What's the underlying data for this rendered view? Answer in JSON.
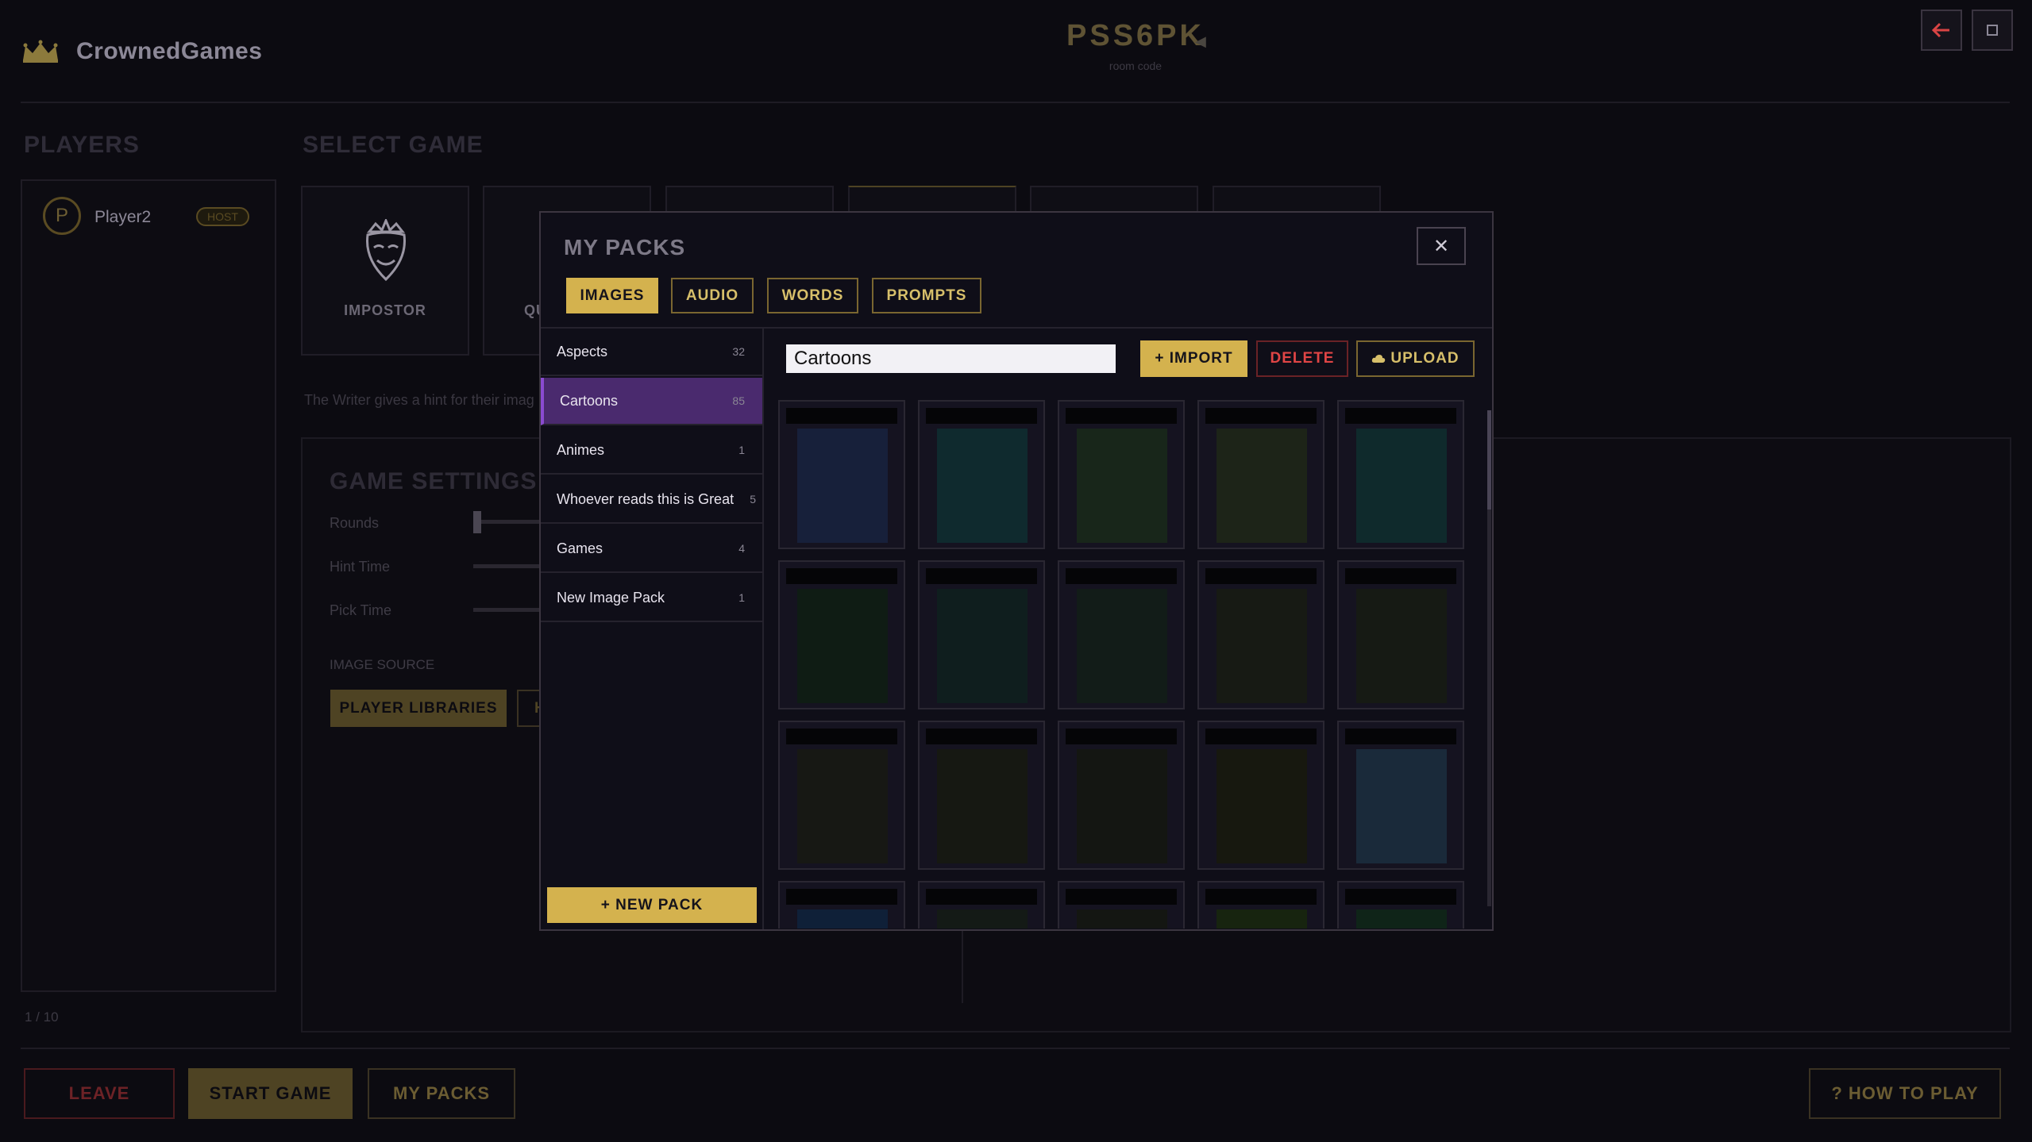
{
  "header": {
    "brand": "CrownedGames",
    "room_code": "PSS6PK",
    "room_code_label": "room code"
  },
  "players": {
    "title": "PLAYERS",
    "list": [
      {
        "initial": "P",
        "name": "Player2",
        "badge": "HOST"
      }
    ],
    "count": "1 / 10"
  },
  "games": {
    "title": "SELECT GAME",
    "cards": [
      {
        "label": "IMPOSTOR"
      },
      {
        "label": "QU"
      }
    ],
    "hint": "The Writer gives a hint for their imag"
  },
  "settings": {
    "title": "GAME SETTINGS",
    "rounds": "Rounds",
    "hint_time": "Hint Time",
    "pick_time": "Pick Time",
    "image_source": "IMAGE SOURCE",
    "player_libraries": "PLAYER LIBRARIES",
    "partial_button": "H"
  },
  "footer": {
    "leave": "LEAVE",
    "start": "START GAME",
    "my_packs": "MY PACKS",
    "how_to_play": "? HOW TO PLAY"
  },
  "modal": {
    "title": "MY PACKS",
    "close": "✕",
    "tabs": [
      "IMAGES",
      "AUDIO",
      "WORDS",
      "PROMPTS"
    ],
    "active_tab": "IMAGES",
    "packs": [
      {
        "name": "Aspects",
        "count": "32"
      },
      {
        "name": "Cartoons",
        "count": "85"
      },
      {
        "name": "Animes",
        "count": "1"
      },
      {
        "name": "Whoever reads this is Great",
        "count": "5"
      },
      {
        "name": "Games",
        "count": "4"
      },
      {
        "name": "New Image Pack",
        "count": "1"
      }
    ],
    "selected_pack": "Cartoons",
    "new_pack": "+ NEW PACK",
    "pack_name_value": "Cartoons",
    "import": "+ IMPORT",
    "delete": "DELETE",
    "upload": "UPLOAD"
  },
  "colors": {
    "accent_gold": "#d4b24e",
    "danger_red": "#e04545",
    "selected_purple": "#4a2a6e"
  }
}
